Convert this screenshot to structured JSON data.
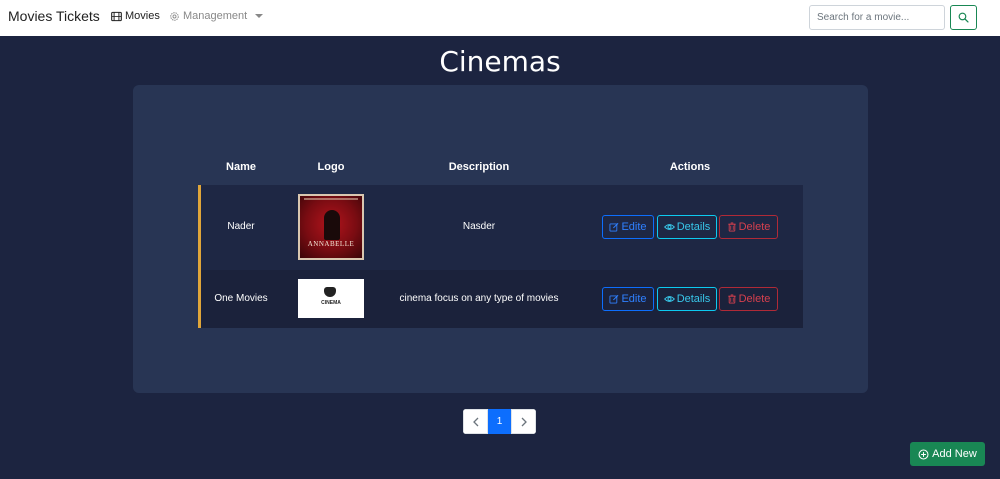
{
  "navbar": {
    "brand": "Movies Tickets",
    "movies_label": "Movies",
    "management_label": "Management",
    "search_placeholder": "Search for a movie...",
    "search_value": ""
  },
  "page_title": "Cinemas",
  "table": {
    "headers": [
      "Name",
      "Logo",
      "Description",
      "Actions"
    ],
    "rows": [
      {
        "name": "Nader",
        "logo_text": "ANNABELLE",
        "description": "Nasder"
      },
      {
        "name": "One Movies",
        "logo_text": "CINEMA",
        "description": "cinema focus on any type of movies"
      }
    ],
    "actions": {
      "edit": "Edite",
      "details": "Details",
      "delete": "Delete"
    }
  },
  "pagination": {
    "prev": "‹",
    "current": "1",
    "next": "›"
  },
  "add_new_label": "Add New",
  "colors": {
    "background": "#1c2440",
    "card": "#283554",
    "row_accent": "#e0a63a",
    "primary": "#0d6efd",
    "info": "#0dcaf0",
    "danger": "#b02a37",
    "success": "#198754"
  },
  "icons": {
    "movies": "film-icon",
    "management": "gear-icon",
    "search": "search-icon",
    "edit": "edit-icon",
    "details": "eye-icon",
    "delete": "trash-icon",
    "add": "plus-circle-icon"
  }
}
